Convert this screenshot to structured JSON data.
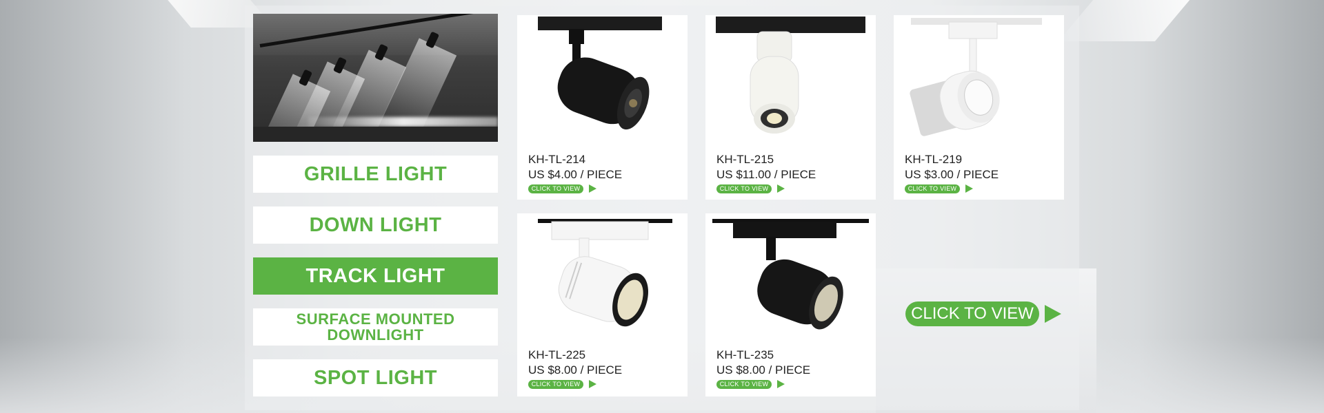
{
  "categories": [
    {
      "label": "GRILLE LIGHT",
      "active": false
    },
    {
      "label": "DOWN LIGHT",
      "active": false
    },
    {
      "label": "TRACK LIGHT",
      "active": true
    },
    {
      "label_line1": "SURFACE MOUNTED",
      "label_line2": "DOWNLIGHT",
      "active": false
    },
    {
      "label": "SPOT LIGHT",
      "active": false
    }
  ],
  "products": [
    {
      "code": "KH-TL-214",
      "price": "US $4.00 / PIECE",
      "button": "CLICK TO VIEW",
      "fixture_color": "black"
    },
    {
      "code": "KH-TL-215",
      "price": "US $11.00 / PIECE",
      "button": "CLICK TO VIEW",
      "fixture_color": "white"
    },
    {
      "code": "KH-TL-219",
      "price": "US $3.00 / PIECE",
      "button": "CLICK TO VIEW",
      "fixture_color": "white"
    },
    {
      "code": "KH-TL-225",
      "price": "US $8.00 / PIECE",
      "button": "CLICK TO VIEW",
      "fixture_color": "white"
    },
    {
      "code": "KH-TL-235",
      "price": "US $8.00 / PIECE",
      "button": "CLICK TO VIEW",
      "fixture_color": "black"
    }
  ],
  "cta": {
    "label": "CLICK TO VIEW",
    "icon": "play-arrow-icon"
  },
  "colors": {
    "accent": "#5bb344",
    "text": "#222222",
    "card_bg": "#ffffff"
  }
}
